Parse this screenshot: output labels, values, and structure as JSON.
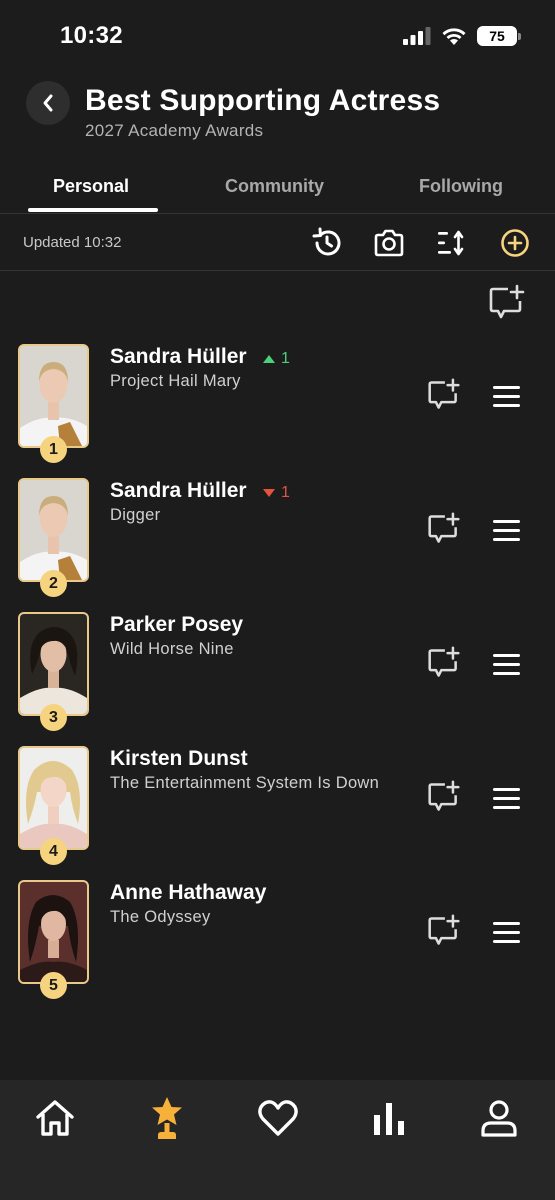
{
  "status": {
    "time": "10:32",
    "battery": "75"
  },
  "header": {
    "title": "Best Supporting Actress",
    "subtitle": "2027 Academy Awards"
  },
  "tabs": [
    {
      "label": "Personal",
      "active": true
    },
    {
      "label": "Community",
      "active": false
    },
    {
      "label": "Following",
      "active": false
    }
  ],
  "toolbar": {
    "updated": "Updated 10:32",
    "icons": [
      "history-icon",
      "camera-icon",
      "sort-icon",
      "add-circle-icon"
    ],
    "accent": "#f6d37e"
  },
  "nominees": [
    {
      "rank": "1",
      "name": "Sandra Hüller",
      "film": "Project Hail Mary",
      "change": "1",
      "direction": "up"
    },
    {
      "rank": "2",
      "name": "Sandra Hüller",
      "film": "Digger",
      "change": "1",
      "direction": "down"
    },
    {
      "rank": "3",
      "name": "Parker Posey",
      "film": "Wild Horse Nine",
      "change": "",
      "direction": ""
    },
    {
      "rank": "4",
      "name": "Kirsten Dunst",
      "film": "The Entertainment System Is Down",
      "change": "",
      "direction": ""
    },
    {
      "rank": "5",
      "name": "Anne Hathaway",
      "film": "The Odyssey",
      "change": "",
      "direction": ""
    }
  ],
  "bottom_nav": [
    {
      "icon": "home-icon",
      "active": false
    },
    {
      "icon": "trophy-icon",
      "active": true
    },
    {
      "icon": "heart-icon",
      "active": false
    },
    {
      "icon": "stats-icon",
      "active": false
    },
    {
      "icon": "profile-icon",
      "active": false
    }
  ],
  "colors": {
    "background": "#1c1c1c",
    "accent": "#f6d37e",
    "up": "#4cd07a",
    "down": "#e5533f"
  }
}
